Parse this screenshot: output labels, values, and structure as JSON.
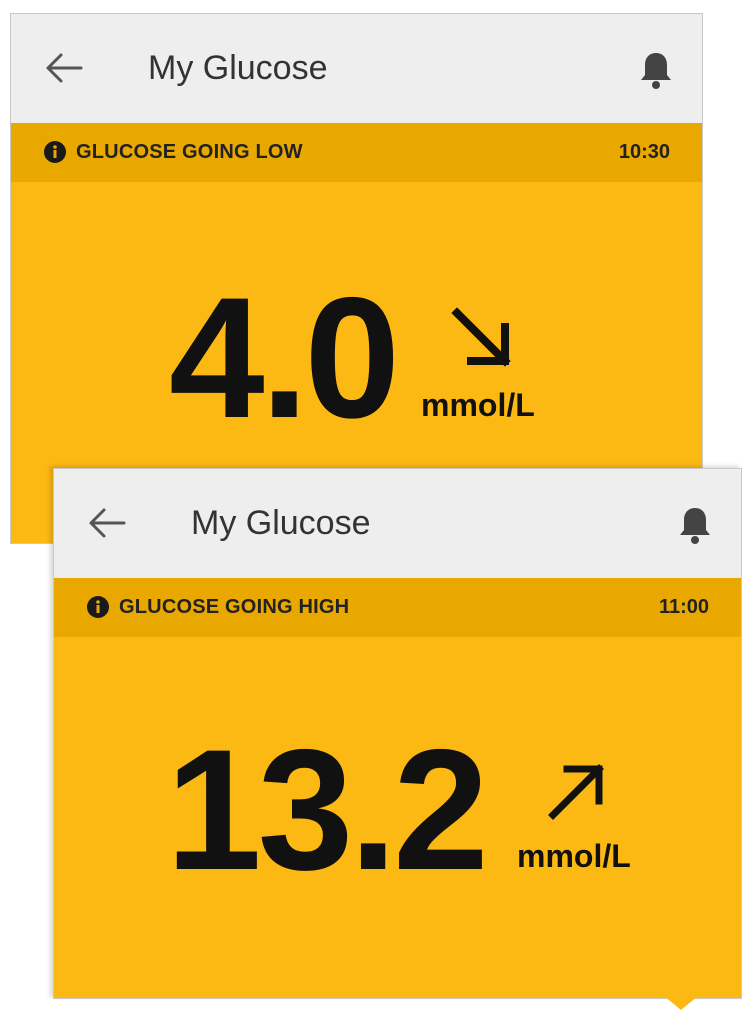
{
  "screens": [
    {
      "app_title": "My Glucose",
      "alert_text": "GLUCOSE GOING LOW",
      "alert_time": "10:30",
      "glucose_value": "4.0",
      "unit": "mmol/L",
      "trend": "falling",
      "trend_icon": "arrow-down-right-icon"
    },
    {
      "app_title": "My Glucose",
      "alert_text": "GLUCOSE GOING HIGH",
      "alert_time": "11:00",
      "glucose_value": "13.2",
      "unit": "mmol/L",
      "trend": "rising",
      "trend_icon": "arrow-up-right-icon"
    }
  ],
  "icons": {
    "back": "back-arrow-icon",
    "notifications": "bell-icon",
    "alert_info": "info-icon"
  },
  "colors": {
    "alert_background": "#fdb913",
    "banner_background": "#e9a800",
    "app_bar": "#eeeeee",
    "text": "#111111"
  }
}
